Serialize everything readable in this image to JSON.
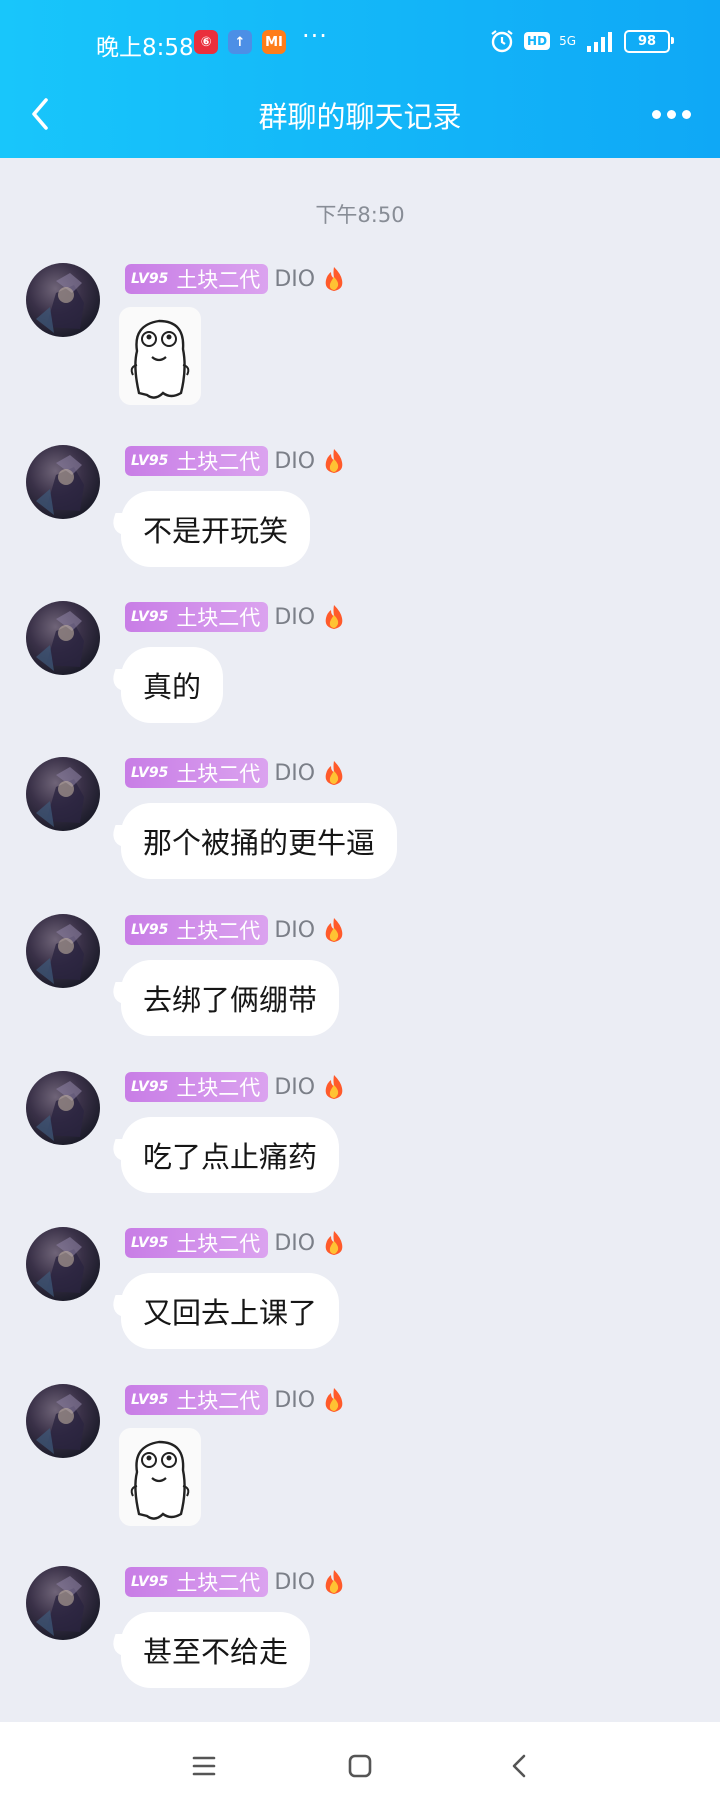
{
  "status_bar": {
    "time": "晚上8:58",
    "apps": [
      {
        "icon": "netease-music-icon",
        "glyph": "⑥",
        "color": "#ea2f3c"
      },
      {
        "icon": "upload-icon",
        "glyph": "↑",
        "color": "#4c8fe6"
      },
      {
        "icon": "xiaomi-icon",
        "glyph": "MI",
        "color": "#ff7d1a"
      }
    ],
    "more_dots": "···",
    "hd": "HD",
    "network": "5G",
    "battery": "98"
  },
  "header": {
    "title": "群聊的聊天记录"
  },
  "chat": {
    "timestamp": "下午8:50",
    "badge_level": "LV95",
    "badge_title": "土块二代",
    "sender_name": "DIO",
    "messages": [
      {
        "type": "sticker"
      },
      {
        "type": "text",
        "text": "不是开玩笑"
      },
      {
        "type": "text",
        "text": "真的"
      },
      {
        "type": "text",
        "text": "那个被捅的更牛逼"
      },
      {
        "type": "text",
        "text": "去绑了俩绷带"
      },
      {
        "type": "text",
        "text": "吃了点止痛药"
      },
      {
        "type": "text",
        "text": "又回去上课了"
      },
      {
        "type": "sticker"
      },
      {
        "type": "text",
        "text": "甚至不给走"
      }
    ]
  },
  "bottom_nav": [
    "menu-icon",
    "home-icon",
    "back-icon"
  ],
  "colors": {
    "header": "#14b4fa",
    "background": "#ebedf4",
    "badge": "#d18ee9"
  }
}
